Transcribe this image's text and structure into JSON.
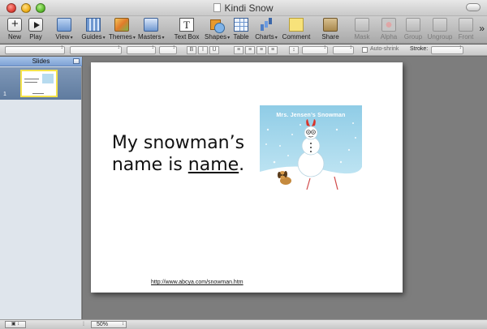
{
  "window": {
    "title": "Kindi Snow"
  },
  "toolbar": {
    "new": "New",
    "play": "Play",
    "view": "View",
    "guides": "Guides",
    "themes": "Themes",
    "masters": "Masters",
    "text_box": "Text Box",
    "shapes": "Shapes",
    "table": "Table",
    "charts": "Charts",
    "comment": "Comment",
    "share": "Share",
    "mask": "Mask",
    "alpha": "Alpha",
    "group": "Group",
    "ungroup": "Ungroup",
    "front": "Front"
  },
  "format_bar": {
    "bold": "B",
    "italic": "I",
    "underline": "U",
    "auto_shrink": "Auto-shrink",
    "stroke": "Stroke:"
  },
  "sidebar": {
    "header": "Slides",
    "slide_number": "1"
  },
  "slide": {
    "line1": "My snowman’s",
    "line2_prefix": "name is ",
    "line2_underlined": "name",
    "line2_suffix": ".",
    "picture_caption": "Mrs. Jensen’s Snowman",
    "link": "http://www.abcya.com/snowman.htm"
  },
  "statusbar": {
    "zoom": "50%"
  },
  "colors": {
    "accent": "#7ea2d5",
    "selection": "#f4e24a",
    "sky": "#b7dbef"
  }
}
